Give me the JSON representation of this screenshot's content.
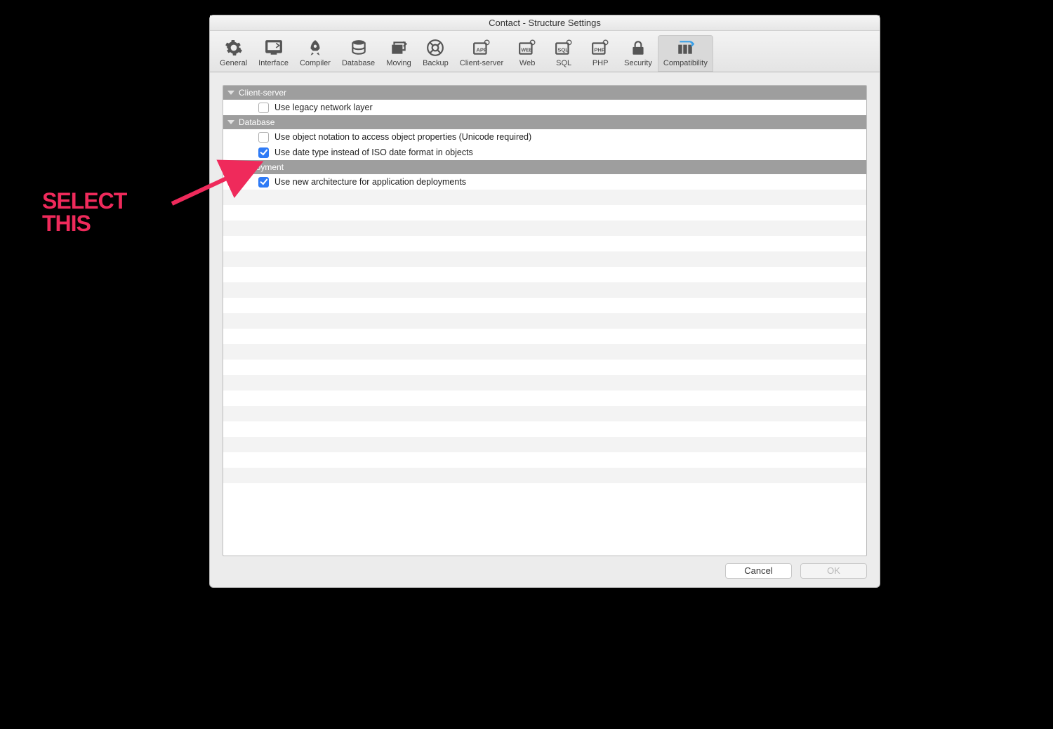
{
  "window": {
    "title": "Contact - Structure Settings"
  },
  "toolbar": {
    "tabs": [
      {
        "label": "General"
      },
      {
        "label": "Interface"
      },
      {
        "label": "Compiler"
      },
      {
        "label": "Database"
      },
      {
        "label": "Moving"
      },
      {
        "label": "Backup"
      },
      {
        "label": "Client-server"
      },
      {
        "label": "Web"
      },
      {
        "label": "SQL"
      },
      {
        "label": "PHP"
      },
      {
        "label": "Security"
      },
      {
        "label": "Compatibility"
      }
    ],
    "active_index": 11
  },
  "sections": [
    {
      "title": "Client-server",
      "rows": [
        {
          "checked": false,
          "label": "Use legacy network layer"
        }
      ]
    },
    {
      "title": "Database",
      "rows": [
        {
          "checked": false,
          "label": "Use object notation to access object properties (Unicode required)"
        },
        {
          "checked": true,
          "label": "Use date type instead of ISO date format in objects"
        }
      ]
    },
    {
      "title": "Deployment",
      "rows": [
        {
          "checked": true,
          "label": "Use new architecture for application deployments"
        }
      ]
    }
  ],
  "buttons": {
    "cancel": "Cancel",
    "ok": "OK"
  },
  "annotation": {
    "line1": "SELECT",
    "line2": "THIS"
  }
}
